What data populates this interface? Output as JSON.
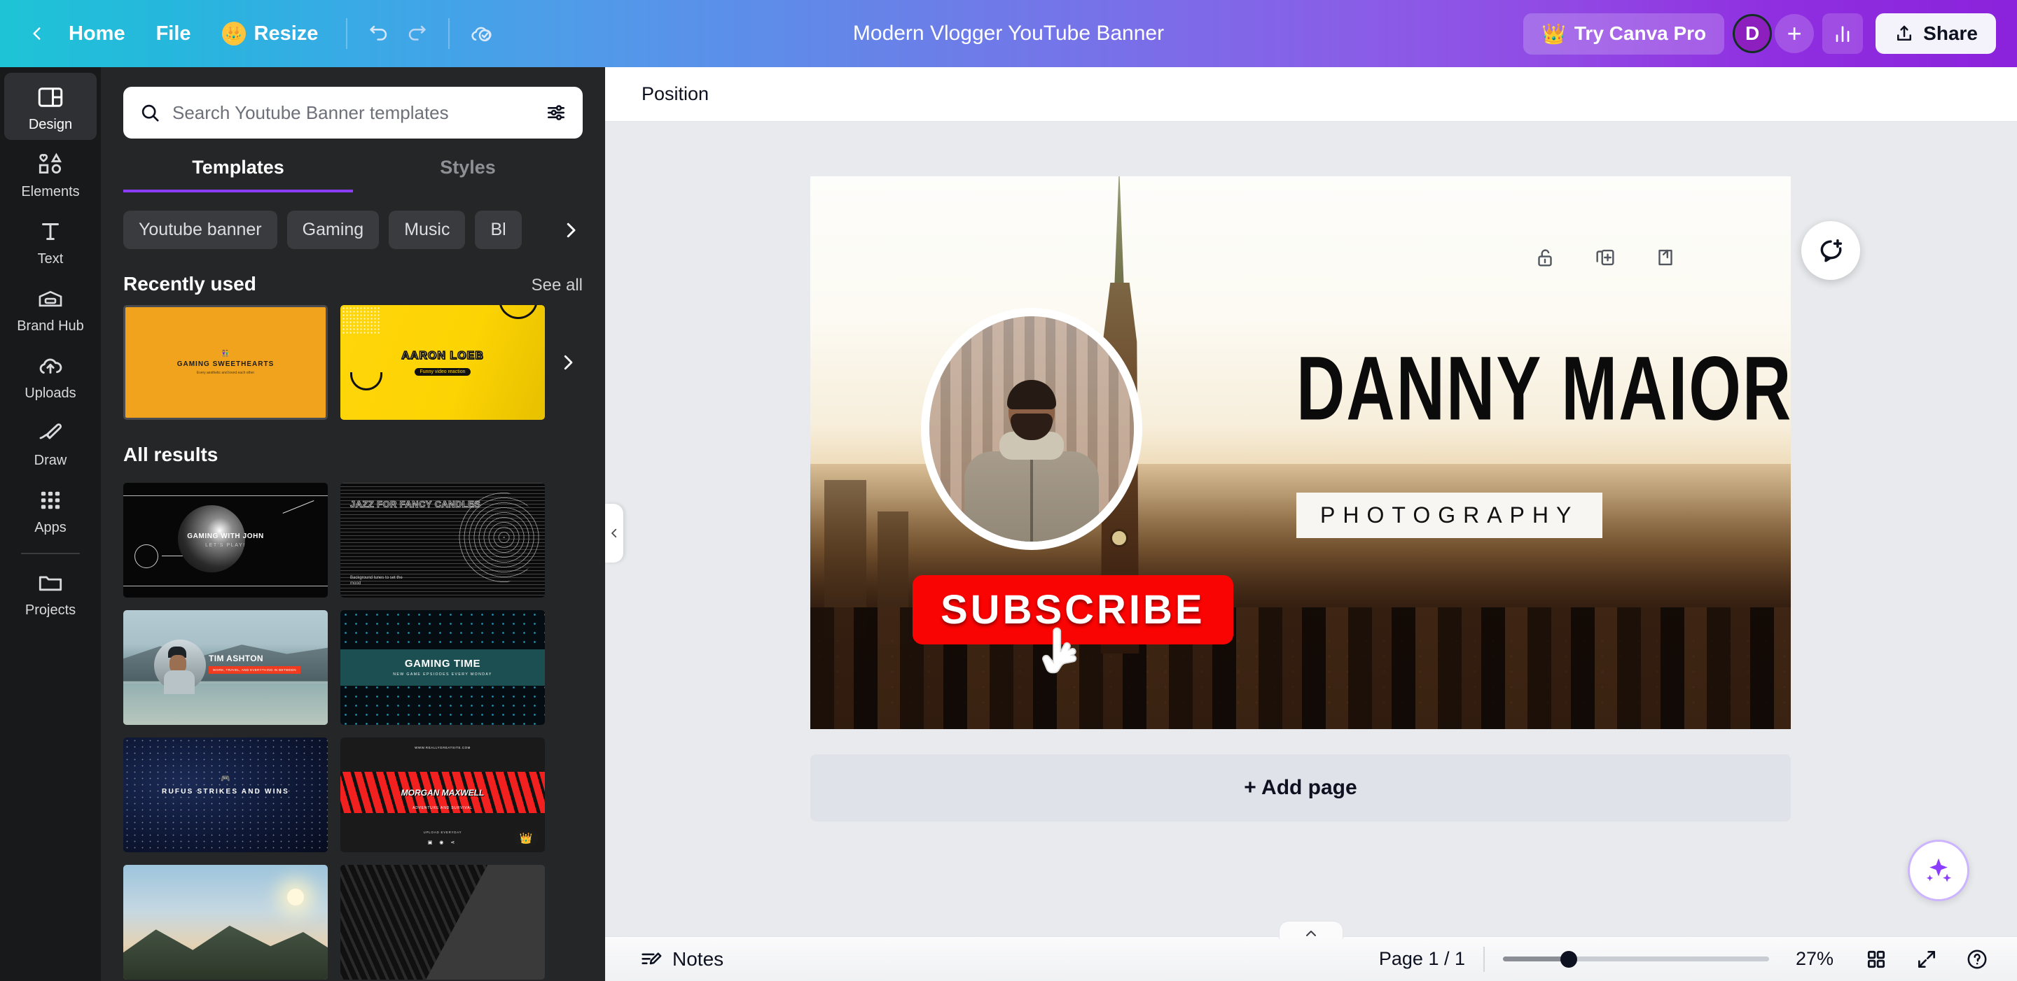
{
  "topbar": {
    "back_icon": "chevron-left-icon",
    "home": "Home",
    "file": "File",
    "resize": "Resize",
    "resize_icon": "crown-icon",
    "undo_icon": "undo-icon",
    "redo_icon": "redo-icon",
    "cloud_icon": "cloud-saved-icon",
    "title": "Modern Vlogger YouTube Banner",
    "try_pro": "Try Canva Pro",
    "try_pro_icon": "crown-icon",
    "avatar_initial": "D",
    "add_collaborator": "+",
    "stats_icon": "insights-bar-icon",
    "share": "Share",
    "share_icon": "upload-arrow-icon"
  },
  "sidebar": {
    "items": [
      {
        "label": "Design",
        "icon": "design-layout-icon",
        "active": true
      },
      {
        "label": "Elements",
        "icon": "shapes-icon",
        "active": false
      },
      {
        "label": "Text",
        "icon": "text-t-icon",
        "active": false
      },
      {
        "label": "Brand Hub",
        "icon": "brand-card-icon",
        "active": false
      },
      {
        "label": "Uploads",
        "icon": "cloud-upload-icon",
        "active": false
      },
      {
        "label": "Draw",
        "icon": "pen-draw-icon",
        "active": false
      },
      {
        "label": "Apps",
        "icon": "grid-dots-icon",
        "active": false
      },
      {
        "label": "Projects",
        "icon": "folder-icon",
        "active": false
      }
    ]
  },
  "panel": {
    "search": {
      "placeholder": "Search Youtube Banner templates",
      "value": "",
      "search_icon": "search-icon",
      "filter_icon": "filter-sliders-icon"
    },
    "tabs": [
      {
        "label": "Templates",
        "active": true
      },
      {
        "label": "Styles",
        "active": false
      }
    ],
    "chips": [
      "Youtube banner",
      "Gaming",
      "Music",
      "Bl"
    ],
    "chip_next_icon": "chevron-right-icon",
    "recent": {
      "title": "Recently used",
      "see_all": "See all",
      "next_icon": "chevron-right-icon",
      "items": [
        {
          "title": "GAMING SWEETHEARTS",
          "sub": "Every aesthetic and loved each other",
          "style": "orange"
        },
        {
          "title": "AARON LOEB",
          "sub": "Funny video reaction",
          "style": "yellow"
        }
      ]
    },
    "results": {
      "title": "All results",
      "items": [
        {
          "title": "GAMING WITH JOHN",
          "sub": "LET'S PLAY!",
          "style": "dark-sphere",
          "pro": false
        },
        {
          "title": "JAZZ FOR FANCY CANDLES",
          "sub": "Background tunes to set the mood",
          "style": "dark-wire",
          "pro": false
        },
        {
          "title": "TIM ASHTON",
          "sub": "WORK, TRAVEL, AND EVERYTHING IN BETWEEN",
          "style": "lake-photo",
          "pro": false
        },
        {
          "title": "GAMING TIME",
          "sub": "NEW GAME EPSIODES EVERY MONDAY",
          "style": "teal-net",
          "pro": false
        },
        {
          "title": "RUFUS STRIKES AND WINS",
          "sub": "",
          "style": "space",
          "pro": false
        },
        {
          "title": "MORGAN MAXWELL",
          "sub": "ADVENTURE AND SURVIVAL",
          "style": "zebra-red",
          "pro": true,
          "site": "WWW.REALLYGREATSITE.COM",
          "footer": "UPLOAD EVERYDAY"
        },
        {
          "title": "",
          "sub": "",
          "style": "mountain-sun",
          "pro": false
        },
        {
          "title": "",
          "sub": "",
          "style": "dark-building",
          "pro": false
        }
      ]
    },
    "collapse_icon": "chevron-left-icon"
  },
  "editor": {
    "toolbar": {
      "position": "Position"
    },
    "page_tools": [
      {
        "icon": "lock-open-icon",
        "name": "lock-page"
      },
      {
        "icon": "duplicate-page-icon",
        "name": "duplicate-page"
      },
      {
        "icon": "export-page-icon",
        "name": "export-page"
      }
    ],
    "comment_icon": "add-comment-icon",
    "ai_icon": "magic-sparkle-icon",
    "add_page": "+ Add page",
    "banner": {
      "name": "DANNY MAIORCA",
      "subtitle": "PHOTOGRAPHY",
      "subscribe": "SUBSCRIBE",
      "cursor_icon": "pointing-hand-icon",
      "subscribe_color": "#fa0303"
    }
  },
  "bottombar": {
    "notes": "Notes",
    "notes_icon": "notes-pencil-icon",
    "page_indicator": "Page 1 / 1",
    "zoom_level": "27%",
    "grid_icon": "grid-view-icon",
    "fullscreen_icon": "expand-diagonal-icon",
    "help_icon": "help-question-icon",
    "collapse_icon": "chevron-up-icon"
  }
}
